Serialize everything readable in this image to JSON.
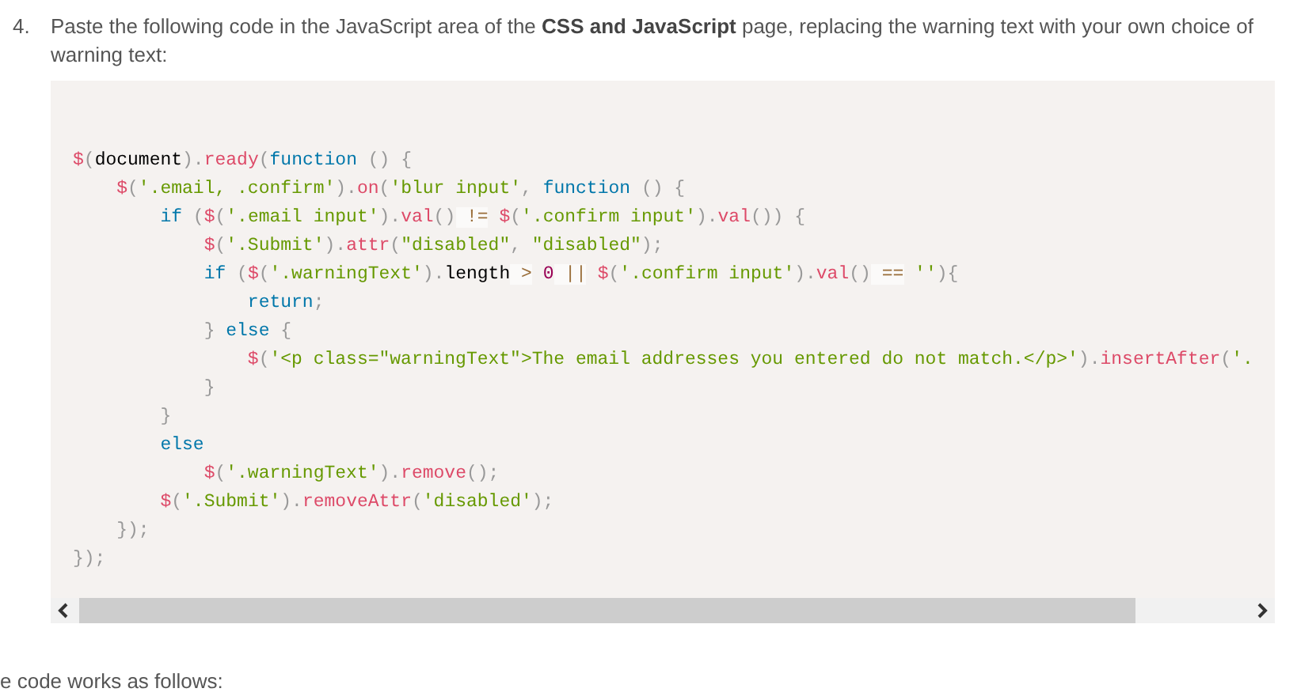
{
  "step": {
    "number": "4.",
    "text": "Paste the following code in the JavaScript area of the **CSS and JavaScript** page, replacing the warning text with your own choice of warning text:"
  },
  "code_lines": [
    [
      {
        "kind": "function",
        "text": "$"
      },
      {
        "kind": "punct",
        "text": "("
      },
      {
        "kind": "plain",
        "text": "document"
      },
      {
        "kind": "punct",
        "text": ")."
      },
      {
        "kind": "function",
        "text": "ready"
      },
      {
        "kind": "punct",
        "text": "("
      },
      {
        "kind": "keyword",
        "text": "function"
      },
      {
        "kind": "punct",
        "text": " () {"
      }
    ],
    [
      {
        "kind": "function",
        "text": "    $"
      },
      {
        "kind": "punct",
        "text": "("
      },
      {
        "kind": "string",
        "text": "'.email, .confirm'"
      },
      {
        "kind": "punct",
        "text": ")."
      },
      {
        "kind": "function",
        "text": "on"
      },
      {
        "kind": "punct",
        "text": "("
      },
      {
        "kind": "string",
        "text": "'blur input'"
      },
      {
        "kind": "punct",
        "text": ","
      },
      {
        "kind": "keyword",
        "text": " function"
      },
      {
        "kind": "punct",
        "text": " () {"
      }
    ],
    [
      {
        "kind": "keyword",
        "text": "        if"
      },
      {
        "kind": "punct",
        "text": " ("
      },
      {
        "kind": "function",
        "text": "$"
      },
      {
        "kind": "punct",
        "text": "("
      },
      {
        "kind": "string",
        "text": "'.email input'"
      },
      {
        "kind": "punct",
        "text": ")."
      },
      {
        "kind": "function",
        "text": "val"
      },
      {
        "kind": "punct",
        "text": "()"
      },
      {
        "kind": "operator",
        "text": " !="
      },
      {
        "kind": "function",
        "text": " $"
      },
      {
        "kind": "punct",
        "text": "("
      },
      {
        "kind": "string",
        "text": "'.confirm input'"
      },
      {
        "kind": "punct",
        "text": ")."
      },
      {
        "kind": "function",
        "text": "val"
      },
      {
        "kind": "punct",
        "text": "()) {"
      }
    ],
    [
      {
        "kind": "function",
        "text": "            $"
      },
      {
        "kind": "punct",
        "text": "("
      },
      {
        "kind": "string",
        "text": "'.Submit'"
      },
      {
        "kind": "punct",
        "text": ")."
      },
      {
        "kind": "function",
        "text": "attr"
      },
      {
        "kind": "punct",
        "text": "("
      },
      {
        "kind": "string",
        "text": "\"disabled\""
      },
      {
        "kind": "punct",
        "text": ","
      },
      {
        "kind": "string",
        "text": " \"disabled\""
      },
      {
        "kind": "punct",
        "text": ");"
      }
    ],
    [
      {
        "kind": "keyword",
        "text": "            if"
      },
      {
        "kind": "punct",
        "text": " ("
      },
      {
        "kind": "function",
        "text": "$"
      },
      {
        "kind": "punct",
        "text": "("
      },
      {
        "kind": "string",
        "text": "'.warningText'"
      },
      {
        "kind": "punct",
        "text": ")."
      },
      {
        "kind": "plain",
        "text": "length"
      },
      {
        "kind": "operator",
        "text": " >"
      },
      {
        "kind": "number",
        "text": " 0"
      },
      {
        "kind": "operator",
        "text": " ||"
      },
      {
        "kind": "function",
        "text": " $"
      },
      {
        "kind": "punct",
        "text": "("
      },
      {
        "kind": "string",
        "text": "'.confirm input'"
      },
      {
        "kind": "punct",
        "text": ")."
      },
      {
        "kind": "function",
        "text": "val"
      },
      {
        "kind": "punct",
        "text": "()"
      },
      {
        "kind": "operator",
        "text": " =="
      },
      {
        "kind": "string",
        "text": " ''"
      },
      {
        "kind": "punct",
        "text": "){"
      }
    ],
    [
      {
        "kind": "keyword",
        "text": "                return"
      },
      {
        "kind": "punct",
        "text": ";"
      }
    ],
    [
      {
        "kind": "punct",
        "text": "            }"
      },
      {
        "kind": "keyword",
        "text": " else"
      },
      {
        "kind": "punct",
        "text": " {"
      }
    ],
    [
      {
        "kind": "function",
        "text": "                $"
      },
      {
        "kind": "punct",
        "text": "("
      },
      {
        "kind": "string",
        "text": "'<p class=\"warningText\">The email addresses you entered do not match.</p>'"
      },
      {
        "kind": "punct",
        "text": ")."
      },
      {
        "kind": "function",
        "text": "insertAfter"
      },
      {
        "kind": "punct",
        "text": "("
      },
      {
        "kind": "string",
        "text": "'."
      }
    ],
    [
      {
        "kind": "punct",
        "text": "            }"
      }
    ],
    [
      {
        "kind": "punct",
        "text": "        }"
      }
    ],
    [
      {
        "kind": "keyword",
        "text": "        else"
      }
    ],
    [
      {
        "kind": "function",
        "text": "            $"
      },
      {
        "kind": "punct",
        "text": "("
      },
      {
        "kind": "string",
        "text": "'.warningText'"
      },
      {
        "kind": "punct",
        "text": ")."
      },
      {
        "kind": "function",
        "text": "remove"
      },
      {
        "kind": "punct",
        "text": "();"
      }
    ],
    [
      {
        "kind": "function",
        "text": "        $"
      },
      {
        "kind": "punct",
        "text": "("
      },
      {
        "kind": "string",
        "text": "'.Submit'"
      },
      {
        "kind": "punct",
        "text": ")."
      },
      {
        "kind": "function",
        "text": "removeAttr"
      },
      {
        "kind": "punct",
        "text": "("
      },
      {
        "kind": "string",
        "text": "'disabled'"
      },
      {
        "kind": "punct",
        "text": ");"
      }
    ],
    [
      {
        "kind": "punct",
        "text": "    });"
      }
    ],
    [
      {
        "kind": "punct",
        "text": "});"
      }
    ]
  ],
  "after_text": "e code works as follows:"
}
